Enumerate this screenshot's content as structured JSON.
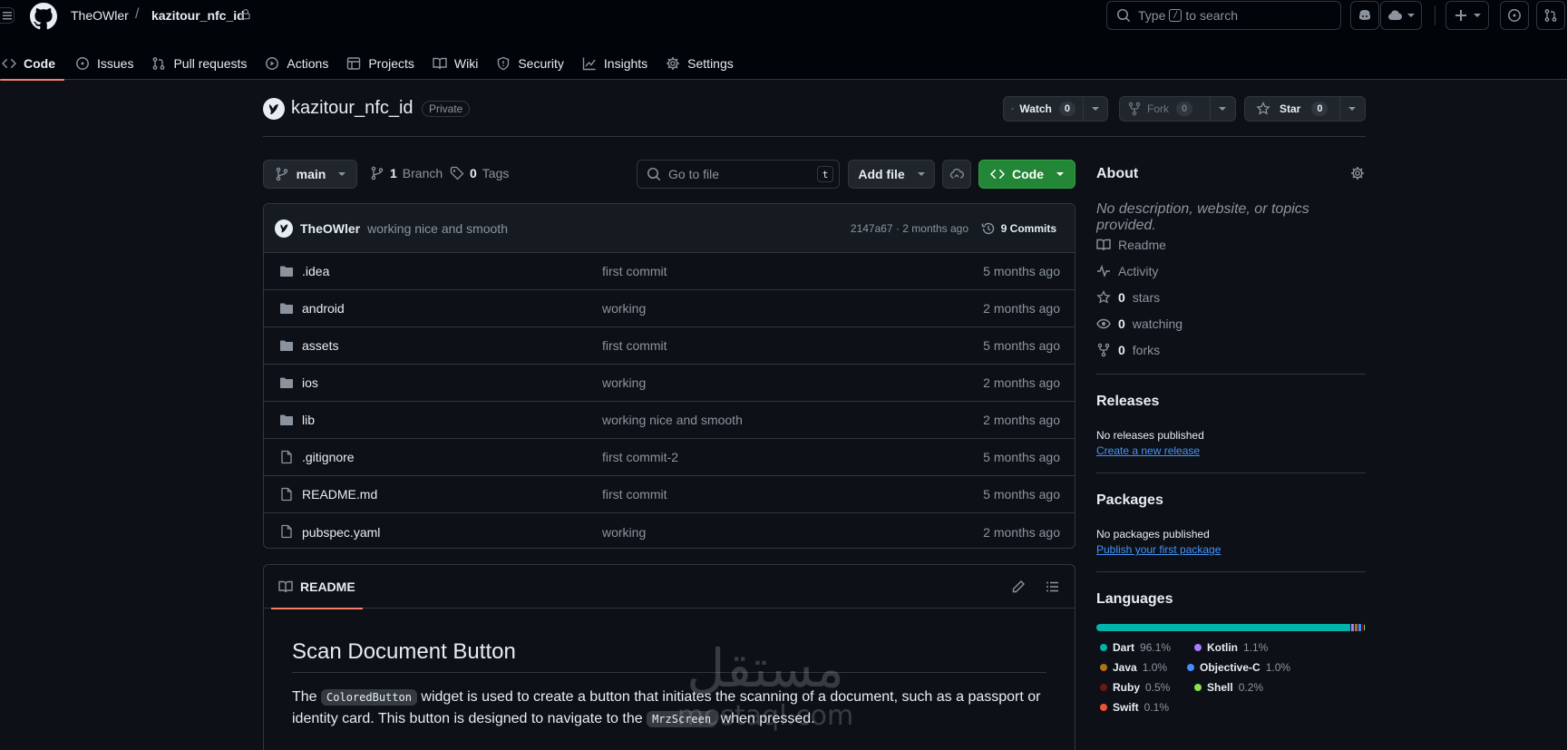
{
  "header": {
    "owner": "TheOWler",
    "separator": "/",
    "repo": "kazitour_nfc_id",
    "search_prefix": "Type",
    "search_key": "/",
    "search_suffix": "to search"
  },
  "nav": [
    {
      "label": "Code",
      "icon": "code-icon",
      "active": true
    },
    {
      "label": "Issues",
      "icon": "issue-icon"
    },
    {
      "label": "Pull requests",
      "icon": "pull-request-icon"
    },
    {
      "label": "Actions",
      "icon": "play-icon"
    },
    {
      "label": "Projects",
      "icon": "table-icon"
    },
    {
      "label": "Wiki",
      "icon": "book-icon"
    },
    {
      "label": "Security",
      "icon": "shield-icon"
    },
    {
      "label": "Insights",
      "icon": "graph-icon"
    },
    {
      "label": "Settings",
      "icon": "gear-icon"
    }
  ],
  "repo": {
    "name": "kazitour_nfc_id",
    "visibility": "Private",
    "watch_label": "Watch",
    "watch_count": "0",
    "fork_label": "Fork",
    "fork_count": "0",
    "star_label": "Star",
    "star_count": "0"
  },
  "toolbar": {
    "branch": "main",
    "branches_count": "1",
    "branches_label": "Branch",
    "tags_count": "0",
    "tags_label": "Tags",
    "goto_placeholder": "Go to file",
    "goto_key": "t",
    "add_file": "Add file",
    "code": "Code"
  },
  "latest_commit": {
    "author": "TheOWler",
    "message": "working nice and smooth",
    "meta": "2147a67 · 2 months ago",
    "commits_label": "9 Commits"
  },
  "files": [
    {
      "name": ".idea",
      "type": "folder",
      "message": "first commit",
      "age": "5 months ago"
    },
    {
      "name": "android",
      "type": "folder",
      "message": "working",
      "age": "2 months ago"
    },
    {
      "name": "assets",
      "type": "folder",
      "message": "first commit",
      "age": "5 months ago"
    },
    {
      "name": "ios",
      "type": "folder",
      "message": "working",
      "age": "2 months ago"
    },
    {
      "name": "lib",
      "type": "folder",
      "message": "working nice and smooth",
      "age": "2 months ago"
    },
    {
      "name": ".gitignore",
      "type": "file",
      "message": "first commit-2",
      "age": "5 months ago"
    },
    {
      "name": "README.md",
      "type": "file",
      "message": "first commit",
      "age": "5 months ago"
    },
    {
      "name": "pubspec.yaml",
      "type": "file",
      "message": "working",
      "age": "2 months ago"
    }
  ],
  "readme": {
    "tab": "README",
    "title": "Scan Document Button",
    "p1": "The",
    "code1": "ColoredButton",
    "p2": "widget is used to create a button that initiates the scanning of a document, such as a passport or identity card. This button is designed to navigate to the",
    "code2": "MrzScreen",
    "p3": "when pressed."
  },
  "about": {
    "title": "About",
    "description": "No description, website, or topics provided.",
    "readme": "Readme",
    "activity": "Activity",
    "stars_count": "0",
    "stars_label": "stars",
    "watching_count": "0",
    "watching_label": "watching",
    "forks_count": "0",
    "forks_label": "forks"
  },
  "releases": {
    "title": "Releases",
    "empty": "No releases published",
    "link": "Create a new release"
  },
  "packages": {
    "title": "Packages",
    "empty": "No packages published",
    "link": "Publish your first package"
  },
  "languages": {
    "title": "Languages",
    "items": [
      {
        "name": "Dart",
        "percent": "96.1%",
        "value": 96.1,
        "color": "#00B4AB"
      },
      {
        "name": "Kotlin",
        "percent": "1.1%",
        "value": 1.1,
        "color": "#A97BFF"
      },
      {
        "name": "Java",
        "percent": "1.0%",
        "value": 1.0,
        "color": "#b07219"
      },
      {
        "name": "Objective-C",
        "percent": "1.0%",
        "value": 1.0,
        "color": "#438eff"
      },
      {
        "name": "Ruby",
        "percent": "0.5%",
        "value": 0.5,
        "color": "#701516"
      },
      {
        "name": "Shell",
        "percent": "0.2%",
        "value": 0.2,
        "color": "#89e051"
      },
      {
        "name": "Swift",
        "percent": "0.1%",
        "value": 0.1,
        "color": "#F05138"
      }
    ]
  },
  "watermark": {
    "arabic": "مستقل",
    "latin": "mostaql.com"
  }
}
